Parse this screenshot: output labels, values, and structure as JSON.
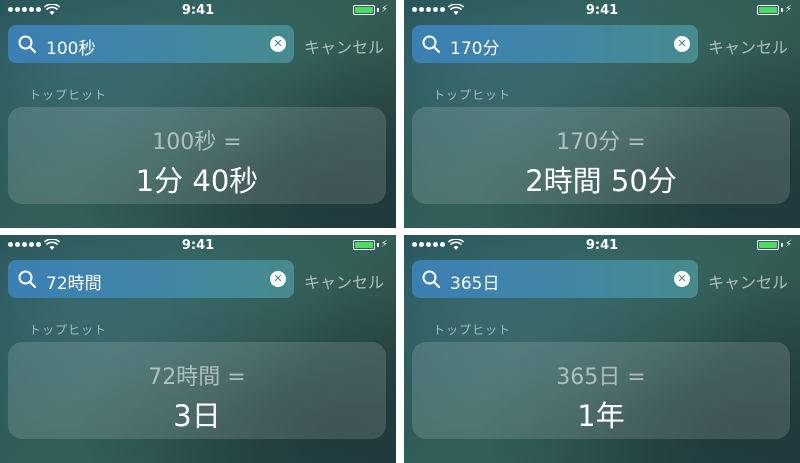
{
  "panels": [
    {
      "time": "9:41",
      "query": "100秒",
      "cancel": "キャンセル",
      "section": "トップヒット",
      "expression": "100秒 =",
      "result": "1分 40秒"
    },
    {
      "time": "9:41",
      "query": "170分",
      "cancel": "キャンセル",
      "section": "トップヒット",
      "expression": "170分 =",
      "result": "2時間 50分"
    },
    {
      "time": "9:41",
      "query": "72時間",
      "cancel": "キャンセル",
      "section": "トップヒット",
      "expression": "72時間 =",
      "result": "3日"
    },
    {
      "time": "9:41",
      "query": "365日",
      "cancel": "キャンセル",
      "section": "トップヒット",
      "expression": "365日 =",
      "result": "1年"
    }
  ],
  "icons": {
    "signal": "signal-dots-icon",
    "wifi": "wifi-icon",
    "battery": "battery-icon",
    "charging": "charging-bolt-icon",
    "search": "search-icon",
    "clear": "clear-icon"
  },
  "colors": {
    "battery_fill": "#4cd964",
    "search_bar": "#3f86a8"
  }
}
